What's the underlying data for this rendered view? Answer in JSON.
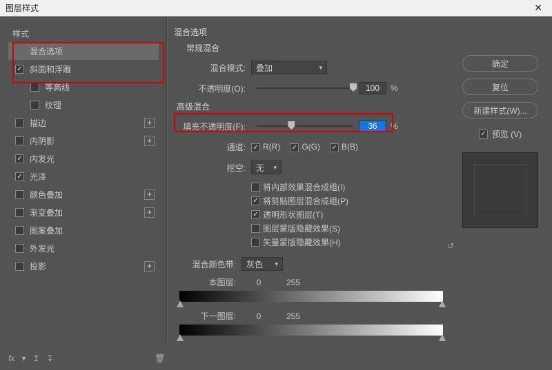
{
  "window": {
    "title": "图层样式"
  },
  "sidebar": {
    "header": "样式",
    "items": [
      {
        "label": "混合选项",
        "checked": false,
        "hasCheck": false,
        "hasPlus": false,
        "selected": true
      },
      {
        "label": "斜面和浮雕",
        "checked": true,
        "hasCheck": true,
        "hasPlus": false
      },
      {
        "label": "等高线",
        "checked": false,
        "hasCheck": true,
        "hasPlus": false,
        "indent": true
      },
      {
        "label": "纹理",
        "checked": false,
        "hasCheck": true,
        "hasPlus": false,
        "indent": true
      },
      {
        "label": "描边",
        "checked": false,
        "hasCheck": true,
        "hasPlus": true
      },
      {
        "label": "内阴影",
        "checked": false,
        "hasCheck": true,
        "hasPlus": true
      },
      {
        "label": "内发光",
        "checked": true,
        "hasCheck": true,
        "hasPlus": false
      },
      {
        "label": "光泽",
        "checked": true,
        "hasCheck": true,
        "hasPlus": false
      },
      {
        "label": "颜色叠加",
        "checked": false,
        "hasCheck": true,
        "hasPlus": true
      },
      {
        "label": "渐变叠加",
        "checked": false,
        "hasCheck": true,
        "hasPlus": true
      },
      {
        "label": "图案叠加",
        "checked": false,
        "hasCheck": true,
        "hasPlus": false
      },
      {
        "label": "外发光",
        "checked": false,
        "hasCheck": true,
        "hasPlus": false
      },
      {
        "label": "投影",
        "checked": false,
        "hasCheck": true,
        "hasPlus": true
      }
    ]
  },
  "main": {
    "section_title": "混合选项",
    "normal_group": "常规混合",
    "blend_mode_label": "混合模式:",
    "blend_mode_value": "叠加",
    "opacity_label": "不透明度(O):",
    "opacity_value": "100",
    "pct": "%",
    "adv_group": "高级混合",
    "fill_opacity_label": "填充不透明度(F):",
    "fill_opacity_value": "36",
    "channels_label": "通道:",
    "ch_r": "R(R)",
    "ch_g": "G(G)",
    "ch_b": "B(B)",
    "knockout_label": "挖空:",
    "knockout_value": "无",
    "opts": [
      {
        "label": "将内部效果混合成组(I)",
        "checked": false
      },
      {
        "label": "将剪贴图层混合成组(P)",
        "checked": true
      },
      {
        "label": "透明形状图层(T)",
        "checked": true
      },
      {
        "label": "图层蒙版隐藏效果(S)",
        "checked": false
      },
      {
        "label": "矢量蒙版隐藏效果(H)",
        "checked": false
      }
    ],
    "blend_if_label": "混合颜色带:",
    "blend_if_value": "灰色",
    "this_layer": "本图层:",
    "under_layer": "下一图层:",
    "range_lo": "0",
    "range_hi": "255"
  },
  "right": {
    "ok": "确定",
    "cancel": "复位",
    "new_style": "新建样式(W)...",
    "preview": "预览 (V)"
  },
  "footer": {
    "fx": "fx"
  }
}
